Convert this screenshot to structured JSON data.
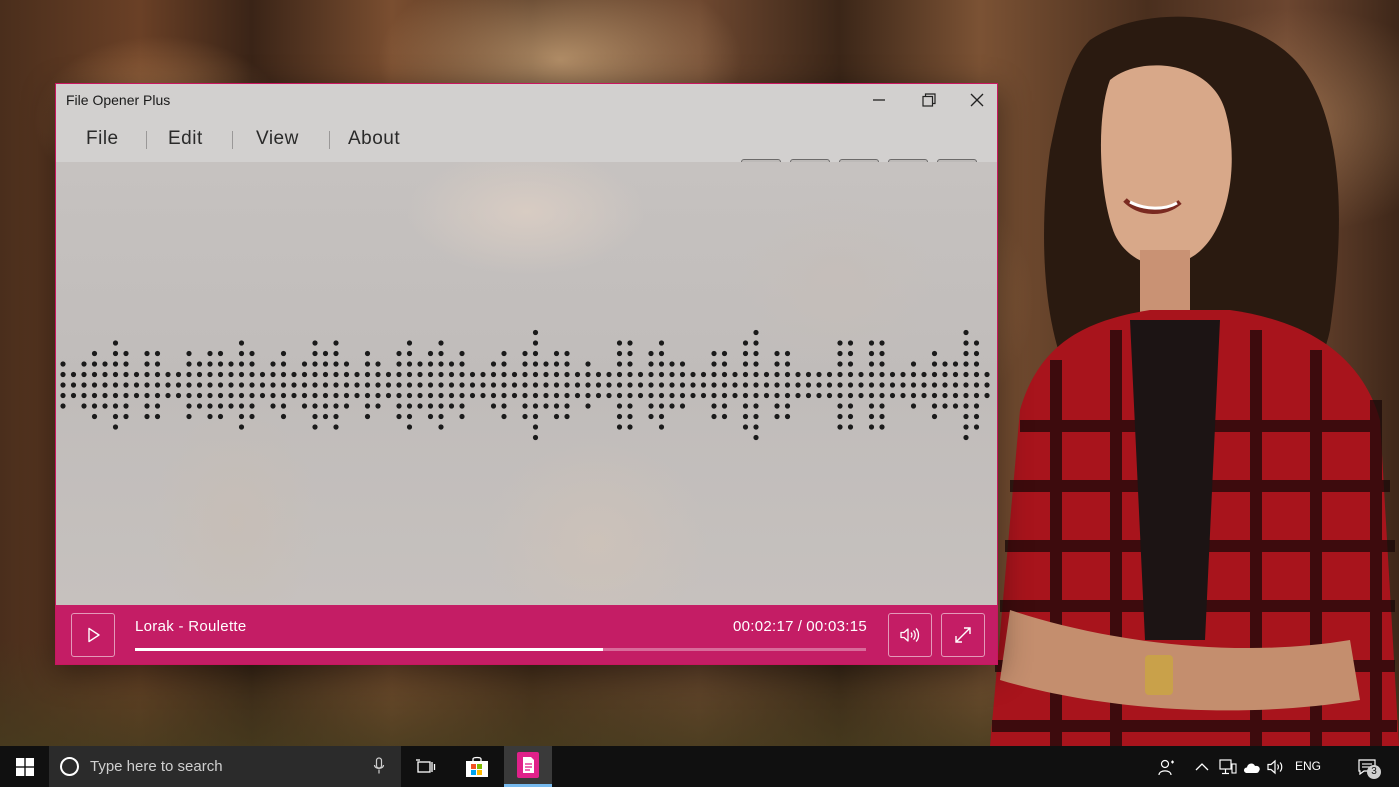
{
  "window": {
    "title": "File Opener Plus",
    "accent_color": "#c41d65"
  },
  "menu": {
    "items": [
      {
        "label": "File"
      },
      {
        "label": "Edit"
      },
      {
        "label": "View"
      },
      {
        "label": "About"
      }
    ]
  },
  "toolbar": {
    "buttons": [
      "edit-icon",
      "info-icon",
      "book-icon",
      "save-icon",
      "share-icon"
    ]
  },
  "player": {
    "track": "Lorak - Roulette",
    "elapsed": "00:02:17",
    "separator": "/",
    "duration": "00:03:15",
    "progress_fraction": 0.64
  },
  "taskbar": {
    "search_placeholder": "Type here to search",
    "language": "ENG",
    "notification_count": "3",
    "pinned": [
      "task-view-icon",
      "store-icon",
      "file-opener-app-icon"
    ]
  }
}
